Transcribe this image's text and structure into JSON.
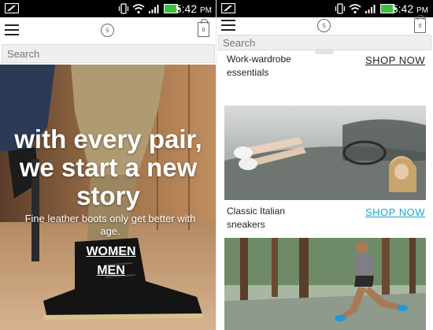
{
  "status": {
    "time": "5:42",
    "ampm": "PM"
  },
  "header": {
    "logo_letter": "S",
    "cart_count": "0"
  },
  "search": {
    "placeholder": "Search"
  },
  "hero": {
    "title_line1": "with every pair,",
    "title_line2": "we start a new",
    "title_line3": "story",
    "subtitle": "Fine leather boots only get better with age.",
    "women_link": "WOMEN",
    "men_link": "MEN"
  },
  "cards": [
    {
      "text_line1": "Work-wardrobe",
      "text_line2": "essentials",
      "cta": "SHOP NOW",
      "cta_color": "#222222"
    },
    {
      "text_line1": "Classic Italian",
      "text_line2": "sneakers",
      "cta": "SHOP NOW",
      "cta_color": "#1fa3c8"
    }
  ]
}
